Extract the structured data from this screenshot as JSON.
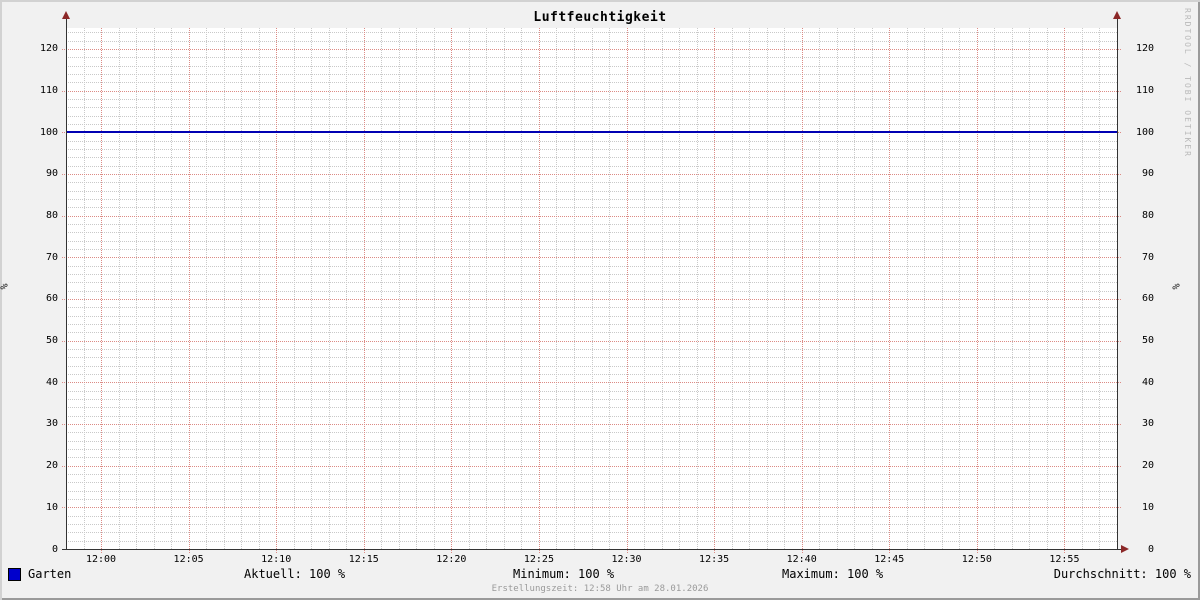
{
  "title": "Luftfeuchtigkeit",
  "watermark": "RRDTOOL / TOBI OETIKER",
  "axis": {
    "left_unit": "%",
    "right_unit": "%"
  },
  "footer": "Erstellungszeit: 12:58 Uhr am 28.01.2026",
  "legend": {
    "series": {
      "label": "Garten",
      "color": "#0000cc"
    },
    "stats": [
      {
        "name": "aktuell",
        "text": "Aktuell: 100 %"
      },
      {
        "name": "minimum",
        "text": "Minimum: 100 %"
      },
      {
        "name": "maximum",
        "text": "Maximum: 100 %"
      },
      {
        "name": "durchschnitt",
        "text": "Durchschnitt: 100 %"
      }
    ]
  },
  "chart_data": {
    "type": "line",
    "title": "Luftfeuchtigkeit",
    "ylabel": "%",
    "ylim": [
      0,
      125
    ],
    "y_major_ticks": [
      0,
      10,
      20,
      30,
      40,
      50,
      60,
      70,
      80,
      90,
      100,
      110,
      120
    ],
    "y_minor_step": 2,
    "x_ticks": [
      "12:00",
      "12:05",
      "12:10",
      "12:15",
      "12:20",
      "12:25",
      "12:30",
      "12:35",
      "12:40",
      "12:45",
      "12:50",
      "12:55"
    ],
    "x_range": [
      "11:58",
      "12:58"
    ],
    "x_range_minutes": 60,
    "x_first_tick_offset_min": 2,
    "x_major_step_min": 5,
    "x_minor_step_min": 1,
    "grid": {
      "minor_on": true,
      "major_on": true
    },
    "series": [
      {
        "name": "Garten",
        "color": "#0000b3",
        "constant_value": 100
      }
    ],
    "stats": {
      "aktuell": "100 %",
      "minimum": "100 %",
      "maximum": "100 %",
      "durchschnitt": "100 %"
    },
    "colors": {
      "background": "#f1f1f1",
      "canvas": "#ffffff",
      "minor_grid": "#c9c9c9",
      "major_grid": "#dc8b85",
      "axis": "#333333",
      "arrow": "#8c2828",
      "line": "#0000b3",
      "legend_swatch": "#0000cc"
    }
  }
}
